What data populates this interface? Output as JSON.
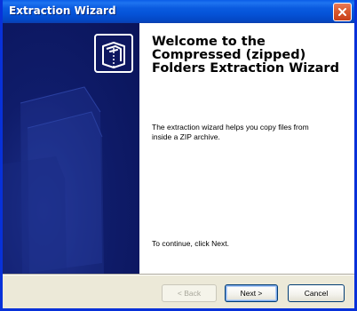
{
  "window": {
    "title": "Extraction Wizard"
  },
  "wizard": {
    "heading": "Welcome to the Compressed (zipped) Folders Extraction Wizard",
    "description": "The extraction wizard helps you copy files from inside a ZIP archive.",
    "continue_text": "To continue, click Next."
  },
  "buttons": {
    "back_label": "< Back",
    "next_label": "Next >",
    "cancel_label": "Cancel",
    "back_enabled": false
  },
  "icons": {
    "close": "close-icon",
    "wizard_logo": "compressed-folder-icon"
  },
  "colors": {
    "title_bar": "#0553d8",
    "side_panel": "#0f1c6a",
    "close_button": "#d95a2f",
    "window_body": "#ece9d8"
  }
}
